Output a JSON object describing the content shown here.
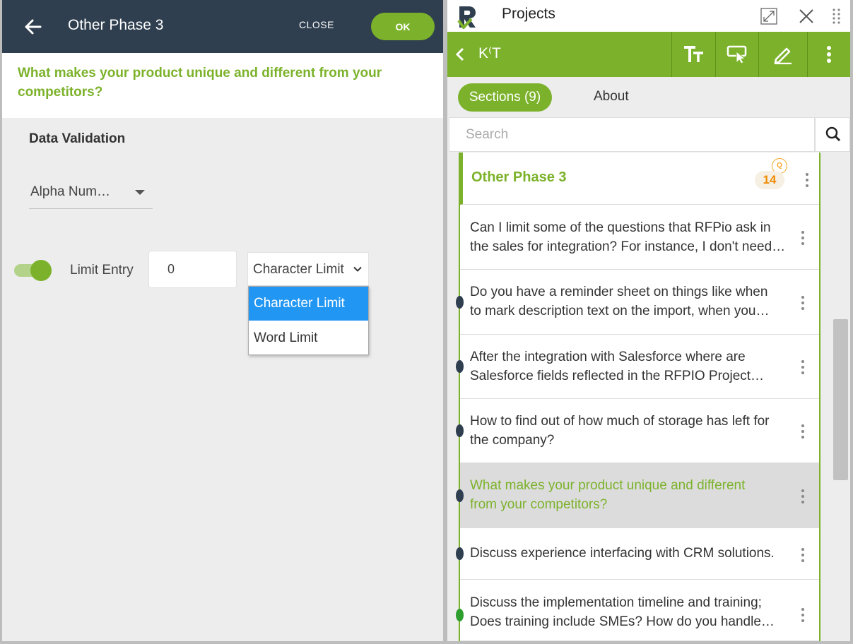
{
  "editor": {
    "title": "Other Phase 3",
    "close_label": "CLOSE",
    "ok_label": "OK",
    "question": "What makes your product unique and different from your competitors?",
    "data_validation_heading": "Data Validation",
    "validation_type": "Alpha Num…",
    "limit_entry_label": "Limit Entry",
    "limit_entry_value": "0",
    "limit_entry_enabled": true,
    "limit_type_selected": "Character Limit",
    "limit_type_options": [
      "Character Limit",
      "Word Limit"
    ]
  },
  "app": {
    "title": "Projects",
    "project_name": "K⁽T",
    "tabs": {
      "sections": "Sections (9)",
      "about": "About"
    },
    "search_placeholder": "Search",
    "section": {
      "title": "Other Phase 3",
      "badge_icon_text": "Q",
      "count": "14"
    },
    "questions": [
      {
        "line1": "Can I limit some of the questions that RFPio ask in",
        "line2": "the sales for integration? For instance, I don't need…"
      },
      {
        "line1": "Do you have a reminder sheet on things like when",
        "line2": "to mark description text on the import, when you…"
      },
      {
        "line1": "After the integration with Salesforce where are",
        "line2": "Salesforce fields reflected in the RFPIO Project…"
      },
      {
        "line1": "How to find out of how much of storage has left for",
        "line2": "the company?"
      },
      {
        "line1": "What makes your product unique and different",
        "line2": "from your competitors?"
      },
      {
        "line1": "Discuss experience interfacing with CRM solutions.",
        "line2": ""
      },
      {
        "line1": "Discuss the implementation timeline and training;",
        "line2": "Does training include SMEs? How do you handle…"
      }
    ],
    "colors": {
      "brand_green": "#7cb22b",
      "header_navy": "#2f3f4f",
      "badge_orange": "#f08a00",
      "dropdown_highlight": "#2196f3"
    }
  }
}
